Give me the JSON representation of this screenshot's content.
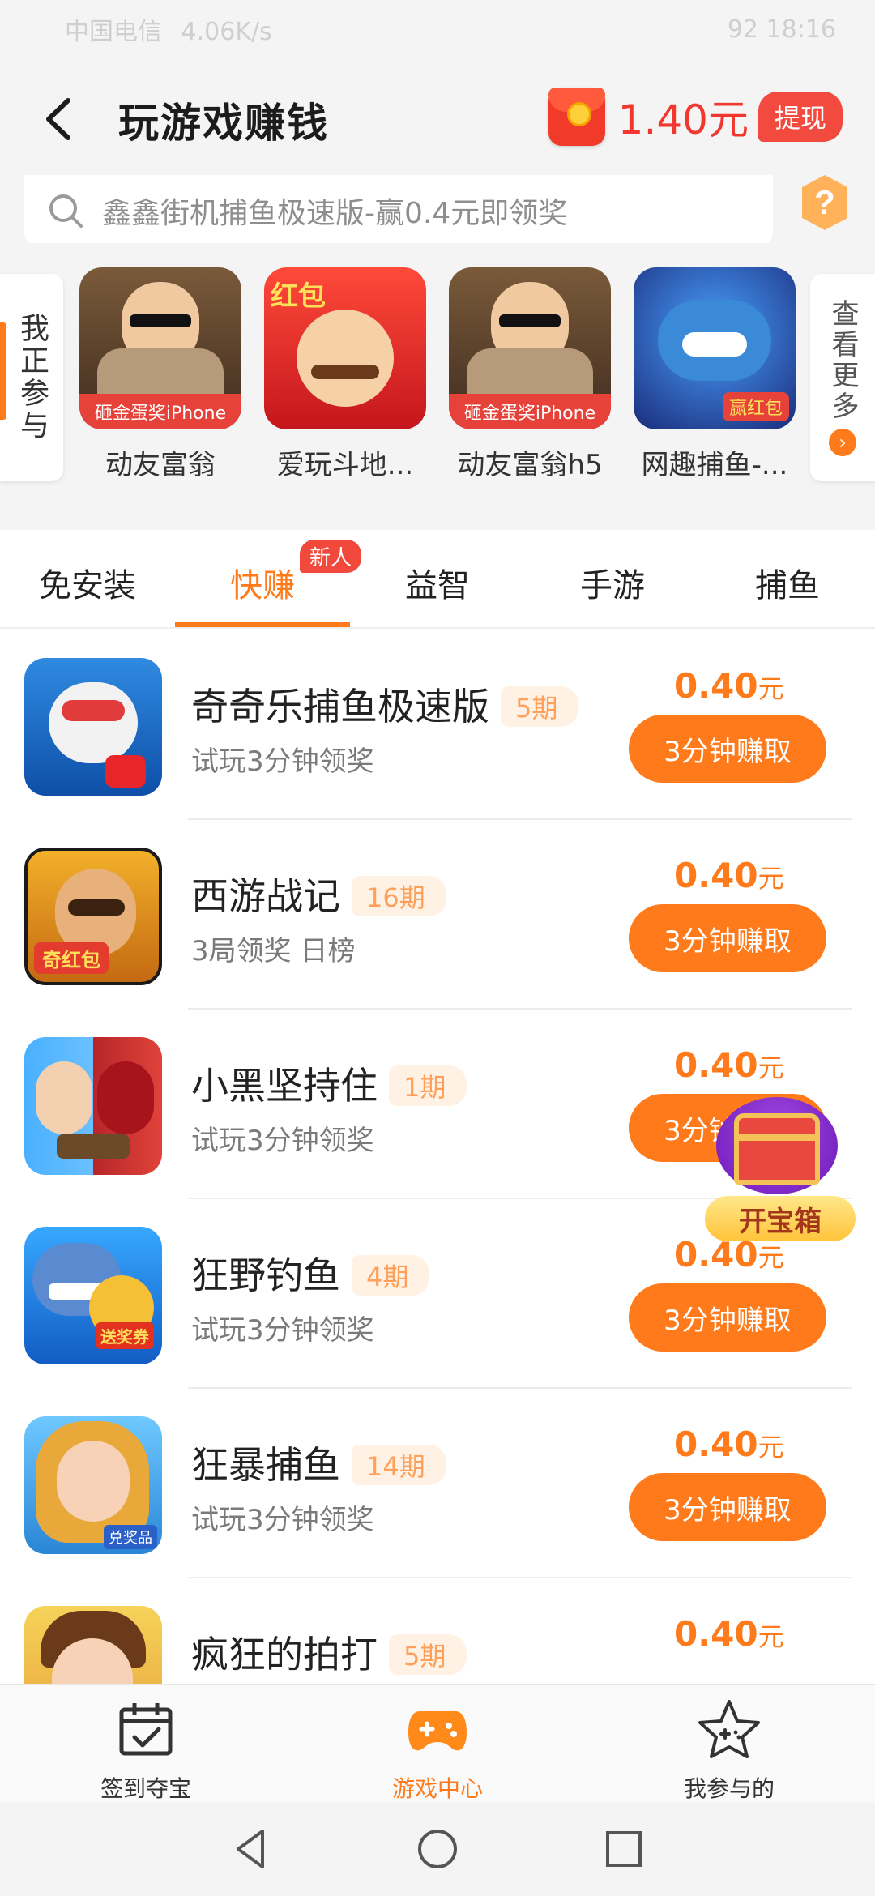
{
  "status_bar": {
    "carrier": "中国电信",
    "speed": "4.06K/s",
    "battery_time": "92 18:16"
  },
  "header": {
    "title": "玩游戏赚钱",
    "balance": "1.40元",
    "withdraw_label": "提现"
  },
  "search": {
    "placeholder": "鑫鑫街机捕鱼极速版-赢0.4元即领奖"
  },
  "joined": {
    "tab_label": "我正参与",
    "view_more_label": "查看更多",
    "items": [
      {
        "name": "动友富翁",
        "icon": "rich-man-game-icon",
        "icon_caption": "砸金蛋奖iPhone"
      },
      {
        "name": "爱玩斗地...",
        "icon": "landlord-game-icon",
        "icon_caption": "红包"
      },
      {
        "name": "动友富翁h5",
        "icon": "rich-man-game-icon",
        "icon_caption": "砸金蛋奖iPhone"
      },
      {
        "name": "网趣捕鱼-...",
        "icon": "fishing-game-icon",
        "icon_caption": "赢红包"
      }
    ]
  },
  "tabs": [
    {
      "label": "免安装"
    },
    {
      "label": "快赚"
    },
    {
      "label": "益智"
    },
    {
      "label": "手游"
    },
    {
      "label": "捕鱼"
    }
  ],
  "new_badge": "新人",
  "games": [
    {
      "name": "奇奇乐捕鱼极速版",
      "period": "5期",
      "subtitle": "试玩3分钟领奖",
      "reward": "0.40",
      "unit": "元",
      "button": "3分钟赚取"
    },
    {
      "name": "西游战记",
      "period": "16期",
      "subtitle": "3局领奖 日榜",
      "reward": "0.40",
      "unit": "元",
      "button": "3分钟赚取"
    },
    {
      "name": "小黑坚持住",
      "period": "1期",
      "subtitle": "试玩3分钟领奖",
      "reward": "0.40",
      "unit": "元",
      "button": "3分钟赚取"
    },
    {
      "name": "狂野钓鱼",
      "period": "4期",
      "subtitle": "试玩3分钟领奖",
      "reward": "0.40",
      "unit": "元",
      "button": "3分钟赚取"
    },
    {
      "name": "狂暴捕鱼",
      "period": "14期",
      "subtitle": "试玩3分钟领奖",
      "reward": "0.40",
      "unit": "元",
      "button": "3分钟赚取"
    },
    {
      "name": "疯狂的拍打",
      "period": "5期",
      "subtitle": "",
      "reward": "0.40",
      "unit": "元",
      "button": ""
    }
  ],
  "treasure": {
    "label": "开宝箱"
  },
  "bottom_nav": [
    {
      "label": "签到夺宝",
      "icon": "calendar-check-icon"
    },
    {
      "label": "游戏中心",
      "icon": "gamepad-icon"
    },
    {
      "label": "我参与的",
      "icon": "star-gamepad-icon"
    }
  ],
  "colors": {
    "accent": "#ff7a1a",
    "red": "#f2382e",
    "background": "#f4f4f4"
  }
}
